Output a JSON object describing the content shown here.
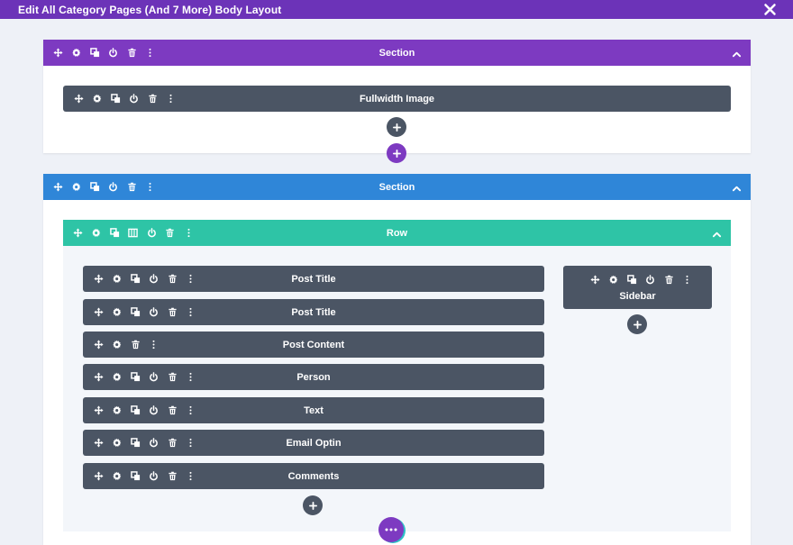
{
  "topbar": {
    "title": "Edit All Category Pages (And 7 More) Body Layout"
  },
  "section1": {
    "label": "Section",
    "color": "#7d3ac1",
    "module": {
      "label": "Fullwidth Image"
    }
  },
  "section2": {
    "label": "Section",
    "color": "#2f86d8",
    "row": {
      "label": "Row",
      "color": "#2ec4a6",
      "modules": [
        {
          "label": "Post Title"
        },
        {
          "label": "Post Title"
        },
        {
          "label": "Post Content"
        },
        {
          "label": "Person"
        },
        {
          "label": "Text"
        },
        {
          "label": "Email Optin"
        },
        {
          "label": "Comments"
        }
      ],
      "sidebar": {
        "label": "Sidebar"
      }
    }
  },
  "colors": {
    "topbar": "#6c33b8",
    "module": "#4b5564",
    "background": "#eef1f7"
  },
  "icons": [
    "move-icon",
    "gear-icon",
    "duplicate-icon",
    "columns-icon",
    "power-icon",
    "trash-icon",
    "more-icon",
    "plus-icon",
    "chevron-up-icon",
    "close-icon"
  ]
}
